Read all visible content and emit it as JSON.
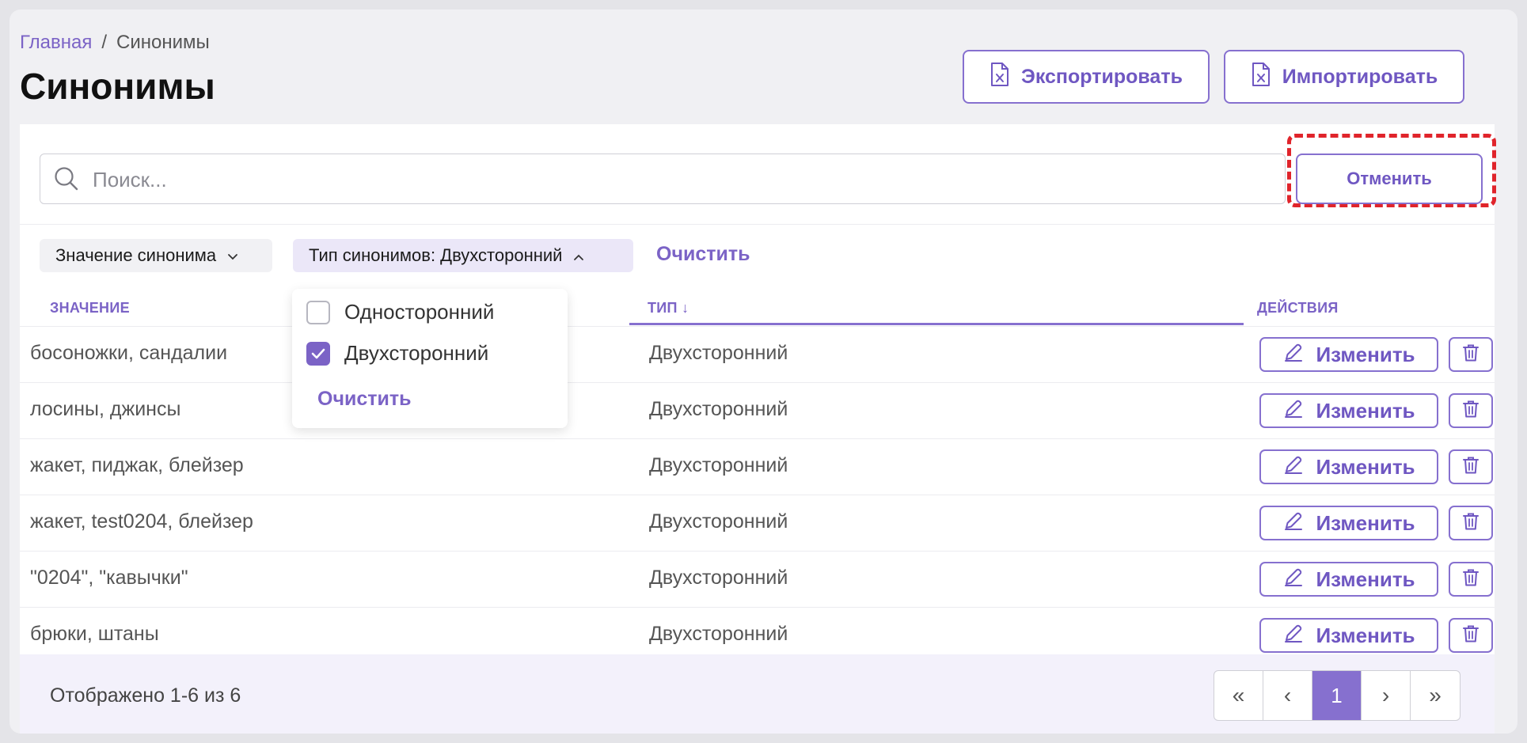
{
  "breadcrumb": {
    "home": "Главная",
    "separator": "/",
    "current": "Синонимы"
  },
  "page": {
    "title": "Синонимы"
  },
  "toolbar": {
    "export_label": "Экспортировать",
    "import_label": "Импортировать"
  },
  "search": {
    "placeholder": "Поиск...",
    "cancel_label": "Отменить"
  },
  "filters": {
    "value_chip": "Значение синонима",
    "type_chip": "Тип синонимов: Двухсторонний",
    "clear_label": "Очистить",
    "dropdown": {
      "options": [
        {
          "label": "Односторонний",
          "checked": false
        },
        {
          "label": "Двухсторонний",
          "checked": true
        }
      ],
      "clear_label": "Очистить"
    }
  },
  "table": {
    "columns": {
      "value": "ЗНАЧЕНИЕ",
      "type": "ТИП",
      "sort_indicator": "↓",
      "actions": "ДЕЙСТВИЯ"
    },
    "edit_label": "Изменить",
    "rows": [
      {
        "value": "босоножки, сандалии",
        "type": "Двухсторонний"
      },
      {
        "value": "лосины, джинсы",
        "type": "Двухсторонний"
      },
      {
        "value": "жакет, пиджак, блейзер",
        "type": "Двухсторонний"
      },
      {
        "value": "жакет, test0204, блейзер",
        "type": "Двухсторонний"
      },
      {
        "value": "\"0204\", \"кавычки\"",
        "type": "Двухсторонний"
      },
      {
        "value": "брюки, штаны",
        "type": "Двухсторонний"
      }
    ]
  },
  "footer": {
    "summary": "Отображено 1-6 из 6",
    "pager": {
      "first": "«",
      "prev": "‹",
      "current": "1",
      "next": "›",
      "last": "»"
    }
  },
  "colors": {
    "accent": "#7b63c6",
    "highlight": "#e0242b"
  }
}
